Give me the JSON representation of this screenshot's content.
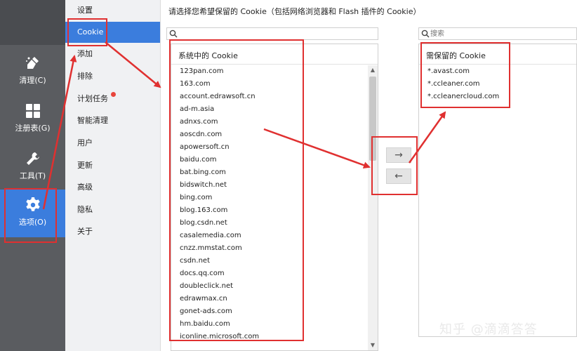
{
  "sidebar": {
    "items": [
      {
        "label": "清理(C)",
        "icon": "broom-icon"
      },
      {
        "label": "注册表(G)",
        "icon": "registry-grid-icon"
      },
      {
        "label": "工具(T)",
        "icon": "wrench-icon"
      },
      {
        "label": "选项(O)",
        "icon": "gear-icon",
        "active": true
      }
    ]
  },
  "menu": {
    "items": [
      {
        "label": "设置"
      },
      {
        "label": "Cookie",
        "active": true
      },
      {
        "label": "添加"
      },
      {
        "label": "排除"
      },
      {
        "label": "计划任务",
        "badge": true
      },
      {
        "label": "智能清理"
      },
      {
        "label": "用户"
      },
      {
        "label": "更新"
      },
      {
        "label": "高级"
      },
      {
        "label": "隐私"
      },
      {
        "label": "关于"
      }
    ]
  },
  "content": {
    "heading": "请选择您希望保留的 Cookie（包括网络浏览器和 Flash 插件的 Cookie）",
    "left_search": {
      "value": "",
      "placeholder": ""
    },
    "right_search": {
      "value": "",
      "placeholder": "搜索"
    },
    "left_panel": {
      "title": "系统中的 Cookie",
      "items": [
        "123pan.com",
        "163.com",
        "account.edrawsoft.cn",
        "ad-m.asia",
        "adnxs.com",
        "aoscdn.com",
        "apowersoft.cn",
        "baidu.com",
        "bat.bing.com",
        "bidswitch.net",
        "bing.com",
        "blog.163.com",
        "blog.csdn.net",
        "casalemedia.com",
        "cnzz.mmstat.com",
        "csdn.net",
        "docs.qq.com",
        "doubleclick.net",
        "edrawmax.cn",
        "gonet-ads.com",
        "hm.baidu.com",
        "iconline.microsoft.com"
      ]
    },
    "move_right_label": "→",
    "move_left_label": "←",
    "right_panel": {
      "title": "需保留的 Cookie",
      "items": [
        "*.avast.com",
        "*.ccleaner.com",
        "*.ccleanercloud.com"
      ]
    }
  },
  "watermark": "知乎 @滴滴答答",
  "colors": {
    "accent": "#3b7ddd",
    "sidebar": "#5a5c60",
    "annotation": "#e03030",
    "badge": "#e8453c"
  }
}
